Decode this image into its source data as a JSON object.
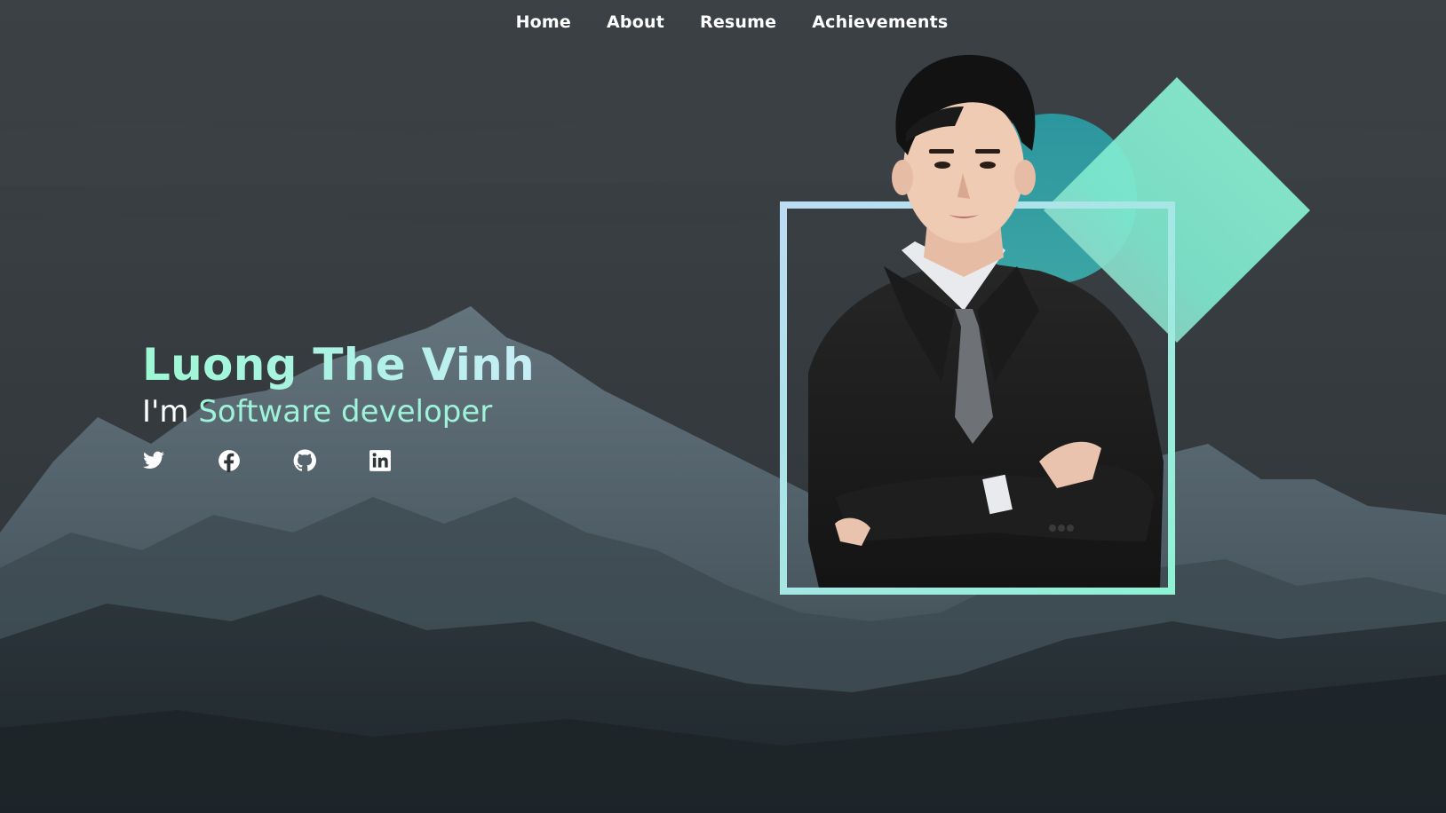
{
  "nav": {
    "items": [
      {
        "label": "Home"
      },
      {
        "label": "About"
      },
      {
        "label": "Resume"
      },
      {
        "label": "Achievements"
      }
    ]
  },
  "hero": {
    "name": "Luong The Vinh",
    "role_prefix": "I'm",
    "role": "Software developer"
  },
  "socials": [
    {
      "icon": "twitter-icon"
    },
    {
      "icon": "facebook-icon"
    },
    {
      "icon": "github-icon"
    },
    {
      "icon": "linkedin-icon"
    }
  ],
  "colors": {
    "accent": "#9ff3d9",
    "frame_start": "#b9dcf3",
    "frame_end": "#8ff0d6",
    "diamond": "#7ff5cf",
    "circle": "#2aa3aa"
  }
}
